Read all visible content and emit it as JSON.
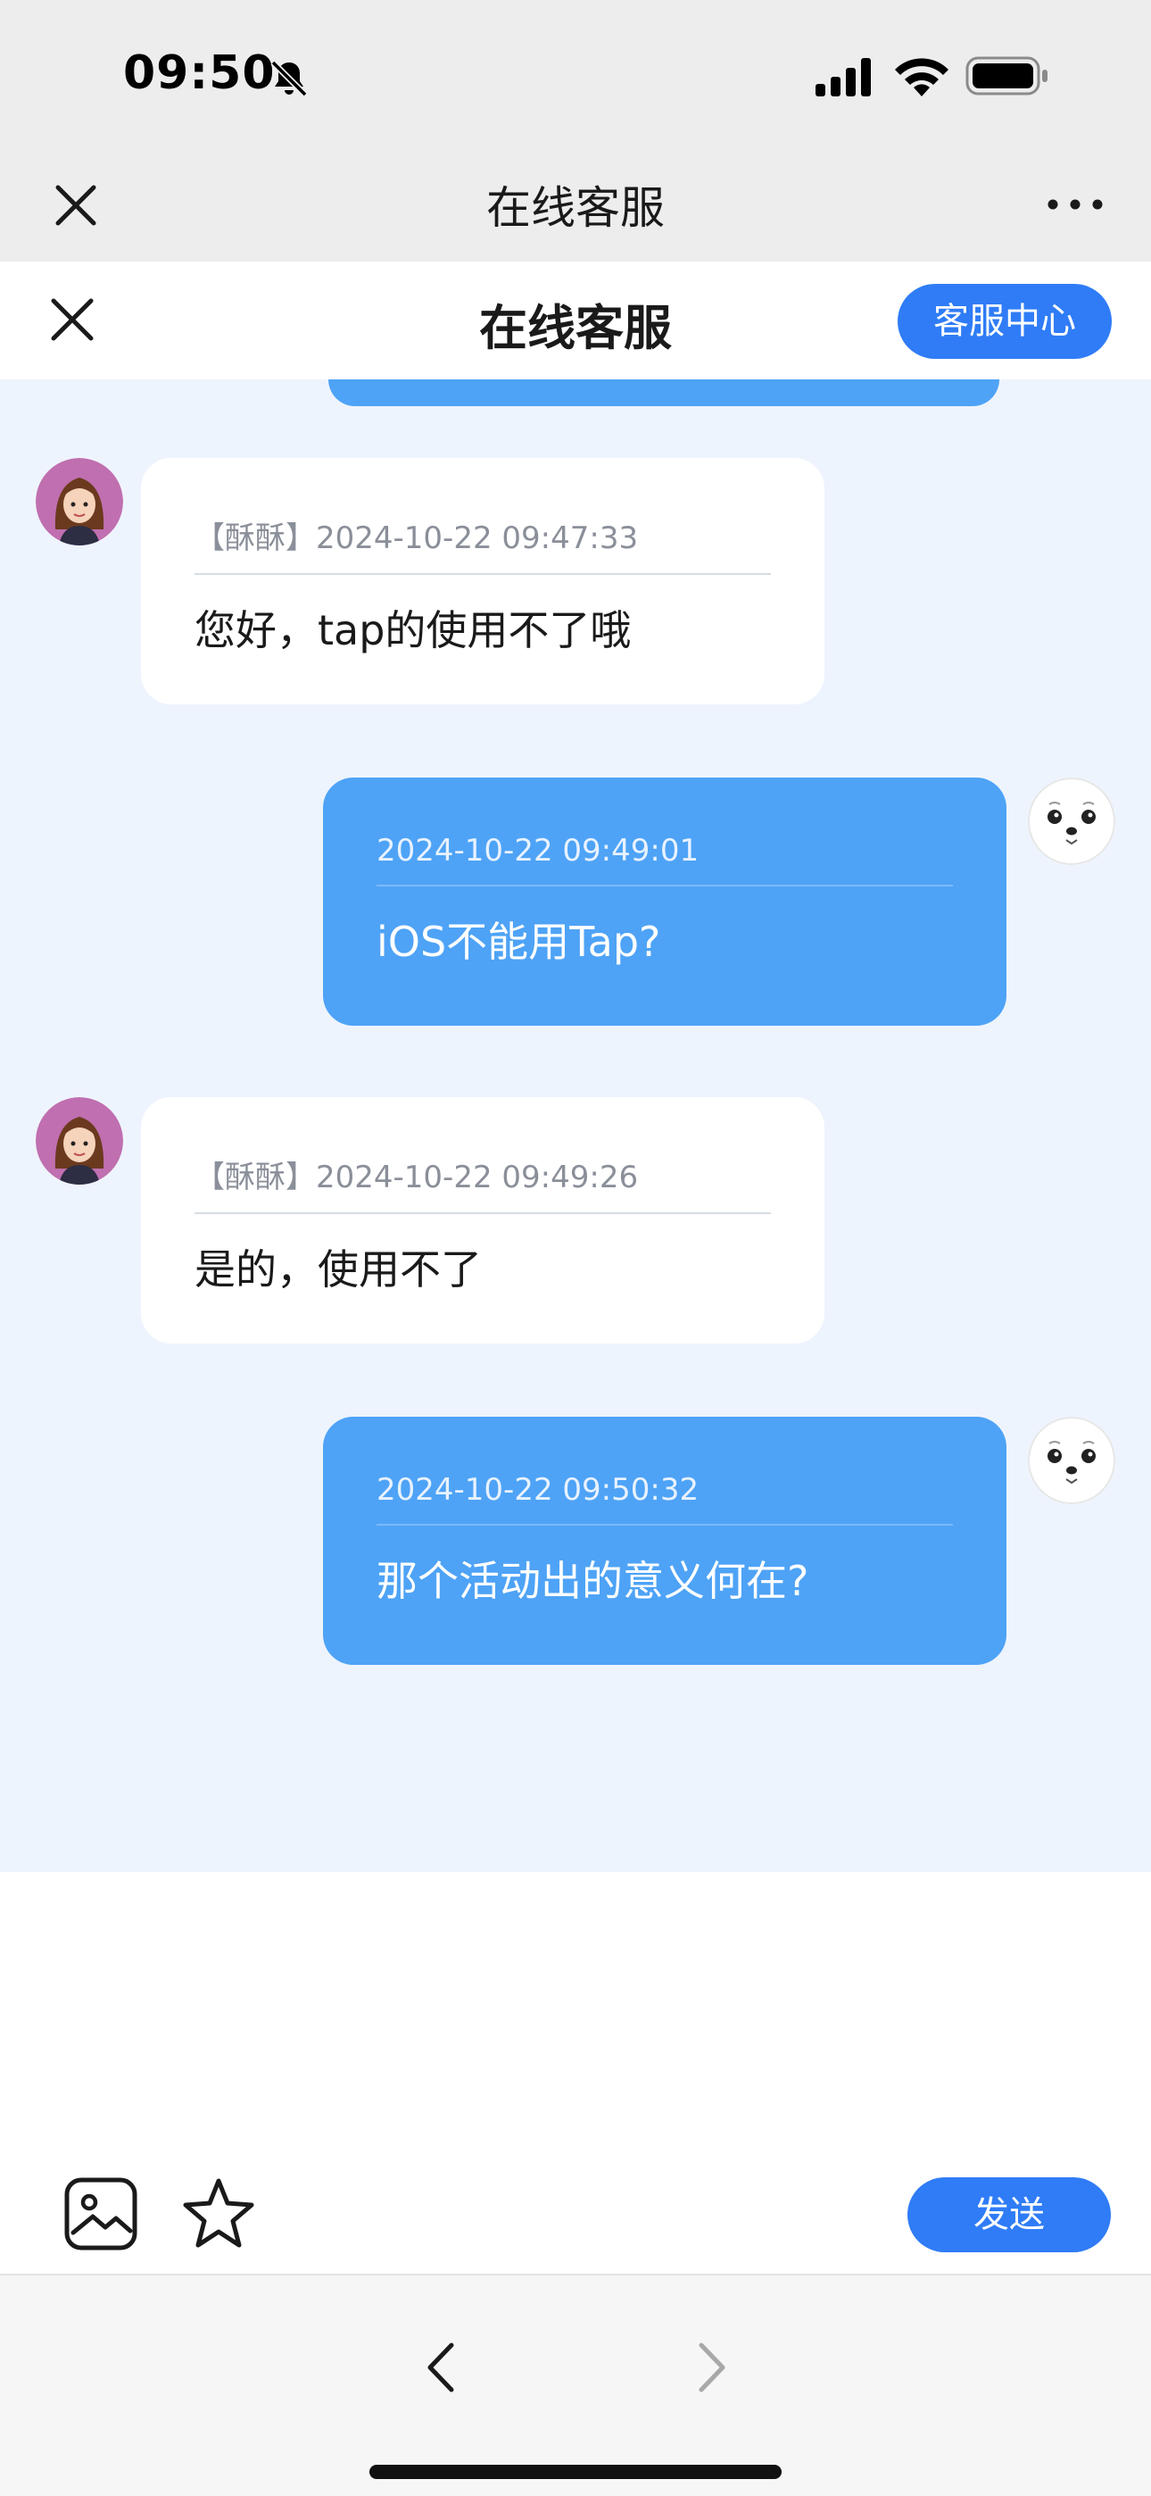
{
  "status_bar": {
    "time": "09:50",
    "icons": [
      "bell-slash-icon",
      "signal-icon",
      "wifi-icon",
      "battery-icon"
    ]
  },
  "outer_nav": {
    "title": "在线客服",
    "close_icon": "close-icon",
    "more_icon": "more-icon"
  },
  "header": {
    "title": "在线客服",
    "service_center_label": "客服中心"
  },
  "messages": [
    {
      "sender": "agent",
      "meta": "【酥酥】2024-10-22 09:47:33",
      "text": "您好，tap的使用不了哦"
    },
    {
      "sender": "user",
      "meta": "2024-10-22 09:49:01",
      "text": "iOS不能用Tap?"
    },
    {
      "sender": "agent",
      "meta": "【酥酥】2024-10-22 09:49:26",
      "text": "是的，使用不了"
    },
    {
      "sender": "user",
      "meta": "2024-10-22 09:50:32",
      "text": "那个活动出的意义何在?"
    }
  ],
  "input_bar": {
    "send_label": "发送",
    "icons": [
      "image-icon",
      "star-icon"
    ]
  },
  "browser_nav": {
    "icons": [
      "back-arrow-icon",
      "forward-arrow-icon"
    ]
  },
  "colors": {
    "accent": "#2f7cf6",
    "user_bubble": "#4ea3f6",
    "chat_background": "#eef4fd"
  }
}
